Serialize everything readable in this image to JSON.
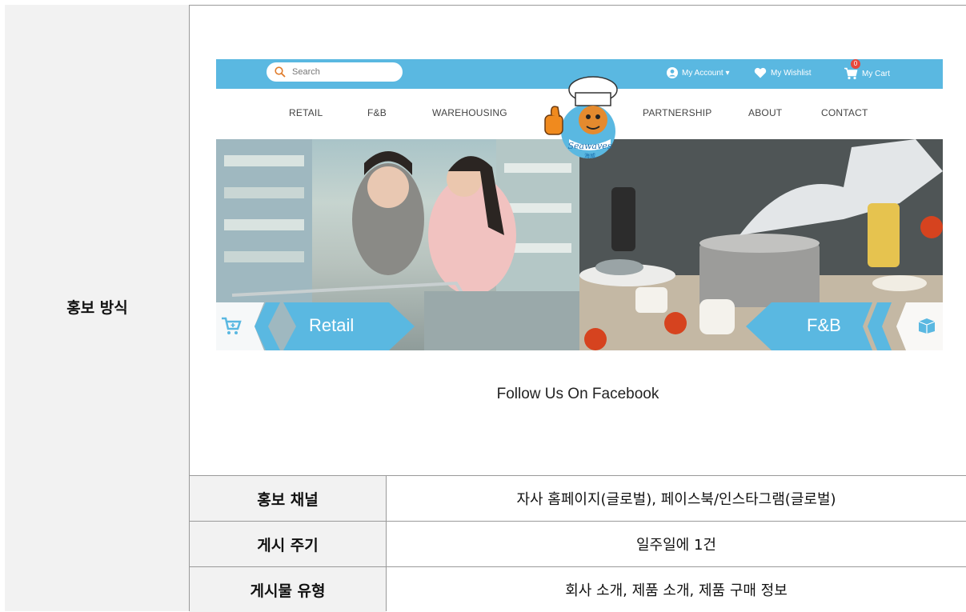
{
  "left_label": "홍보 방식",
  "site": {
    "search_placeholder": "Search",
    "account_label": "My Account ▾",
    "wishlist_label": "My Wishlist",
    "cart_label": "My Cart",
    "cart_count": "0",
    "nav": [
      "RETAIL",
      "F&B",
      "WAREHOUSING",
      "PARTNERSHIP",
      "ABOUT",
      "CONTACT"
    ],
    "logo_text": "Seawaves",
    "logo_subtext": "海威",
    "banner_left_label": "Retail",
    "banner_right_label": "F&B",
    "colors": {
      "topbar": "#5ab8e1",
      "ribbon": "#5ab8e1",
      "badge": "#e8473b"
    }
  },
  "facebook_heading": "Follow Us On Facebook",
  "rows": [
    {
      "key": "홍보 채널",
      "value": "자사 홈페이지(글로벌), 페이스북/인스타그램(글로벌)"
    },
    {
      "key": "게시 주기",
      "value": "일주일에 1건"
    },
    {
      "key": "게시물 유형",
      "value": "회사 소개, 제품 소개, 제품 구매 정보"
    }
  ]
}
